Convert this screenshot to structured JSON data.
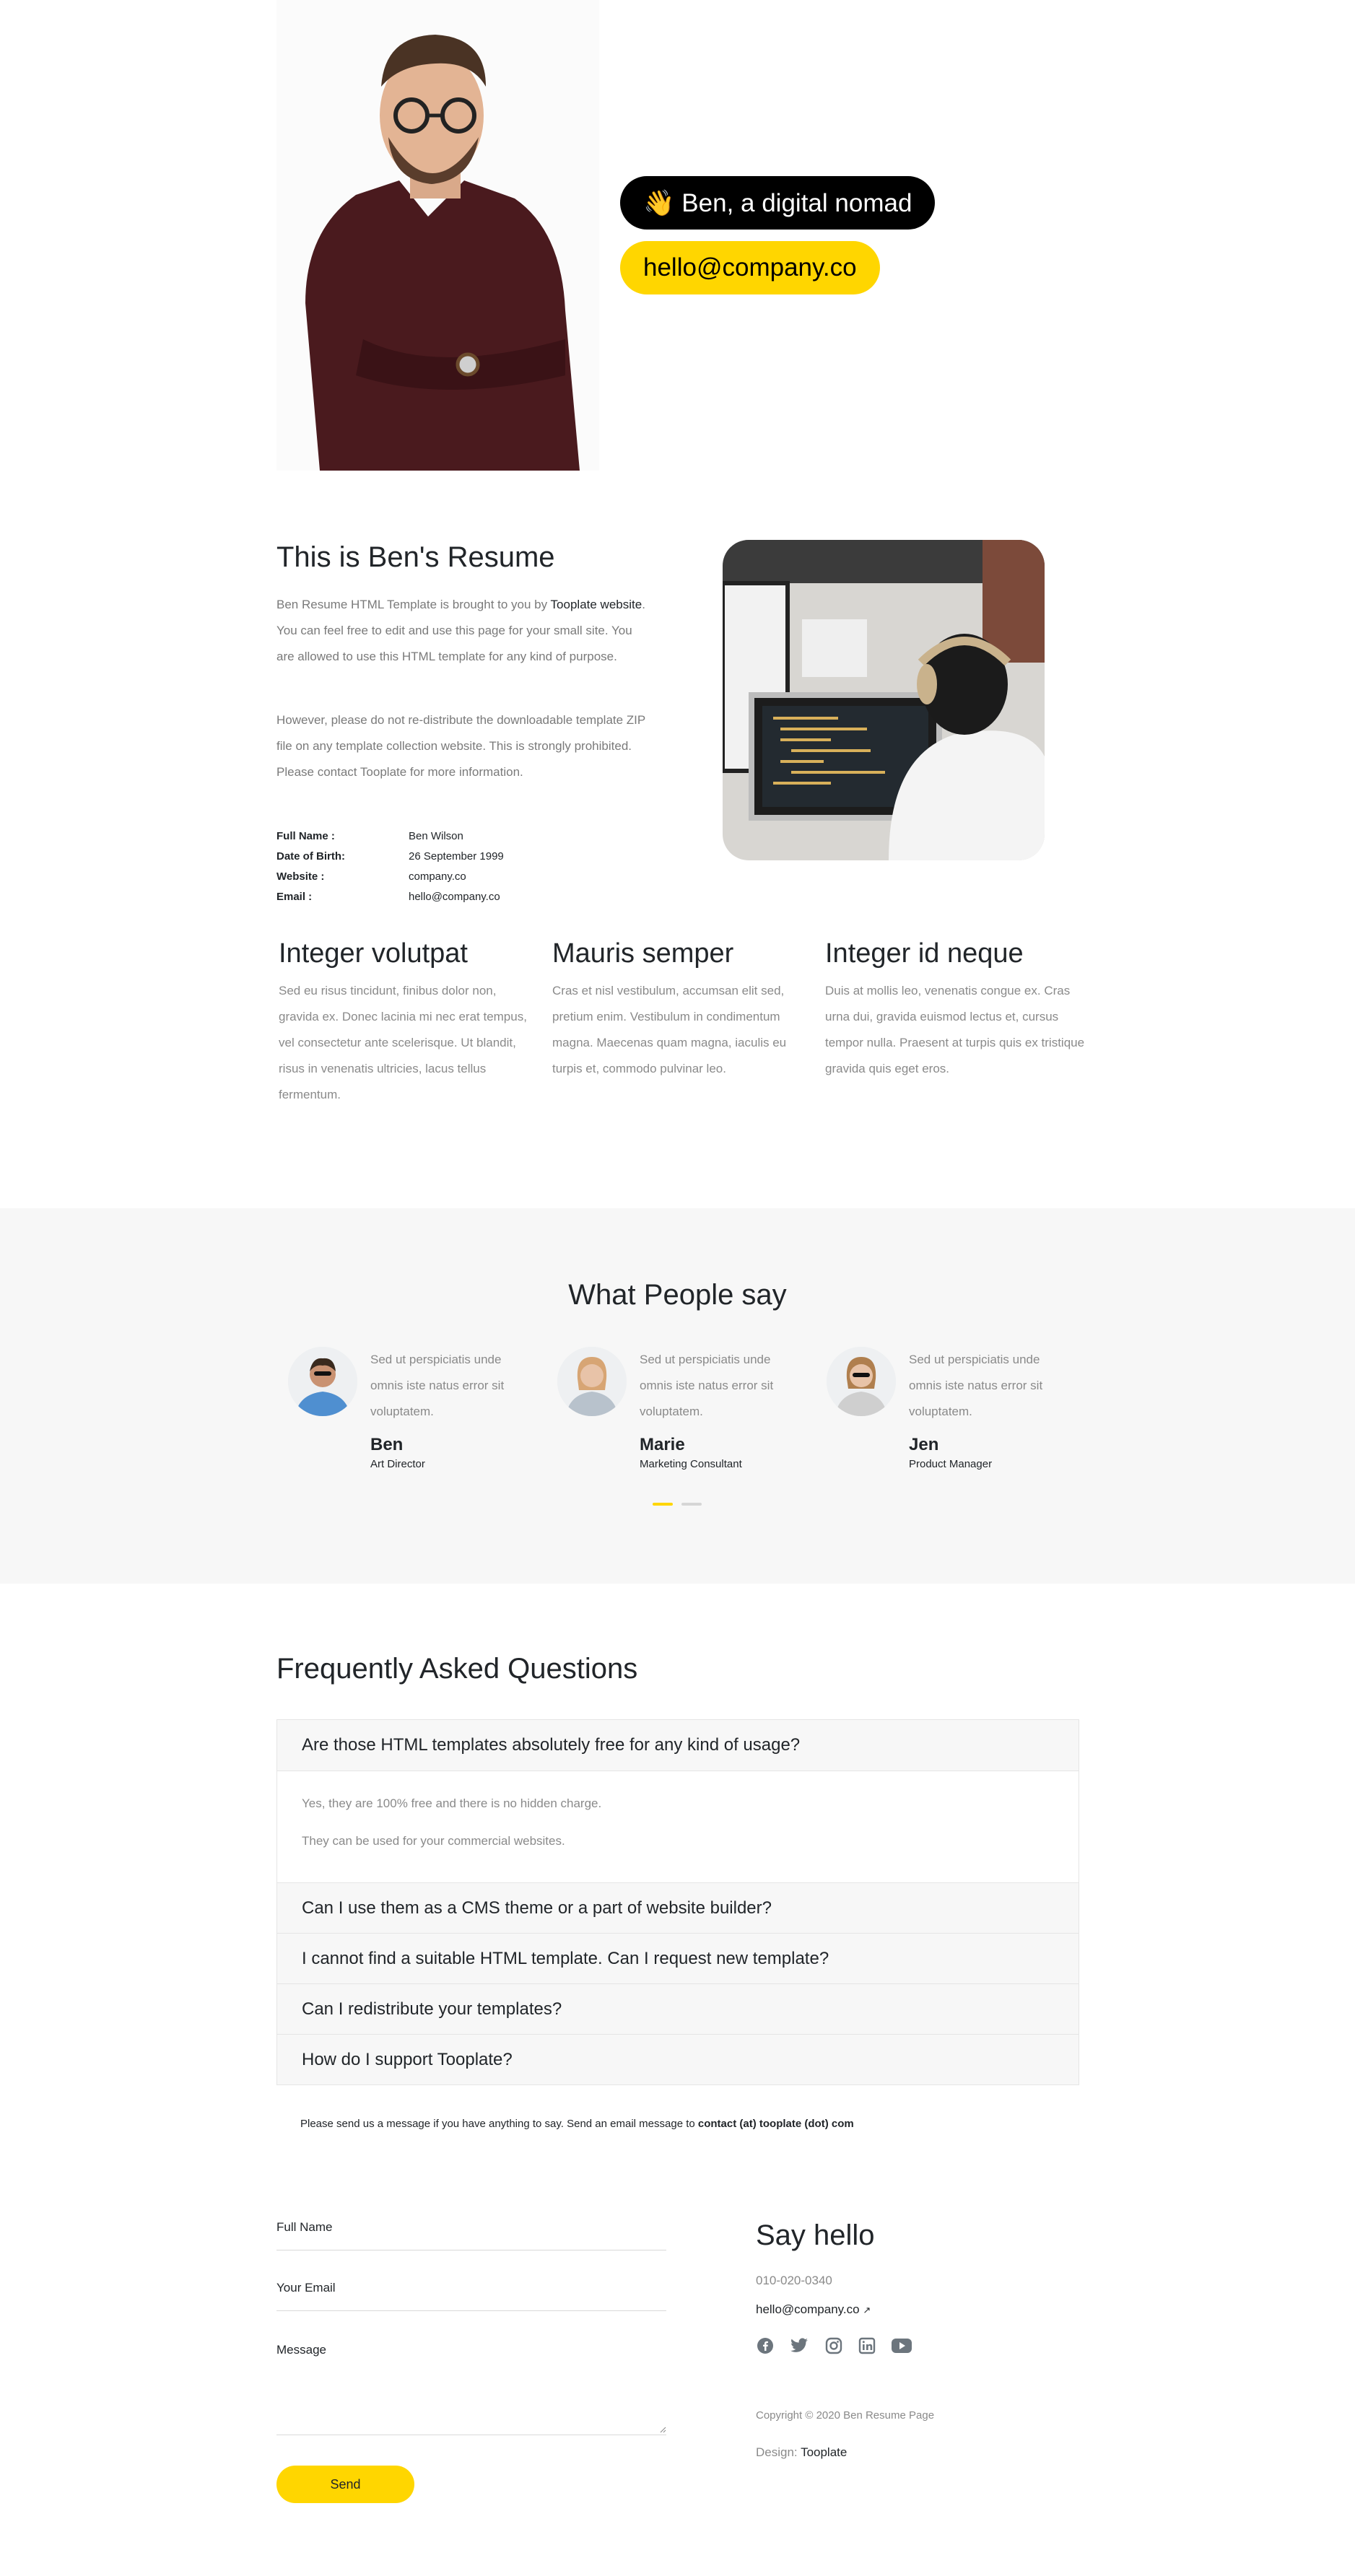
{
  "hero": {
    "name_pill": "👋 Ben, a digital nomad",
    "email_pill": "hello@company.co"
  },
  "about": {
    "title": "This is Ben's Resume",
    "p1_a": "Ben Resume HTML Template is brought to you by ",
    "p1_link": "Tooplate website",
    "p1_b": ". You can feel free to edit and use this page for your small site. You are allowed to use this HTML template for any kind of purpose.",
    "p2": "However, please do not re-distribute the downloadable template ZIP file on any template collection website. This is strongly prohibited. Please contact Tooplate for more information.",
    "info": [
      {
        "k": "Full Name :",
        "v": "Ben Wilson"
      },
      {
        "k": "Date of Birth:",
        "v": "26 September 1999"
      },
      {
        "k": "Website :",
        "v": "company.co"
      },
      {
        "k": "Email :",
        "v": "hello@company.co"
      }
    ]
  },
  "features": [
    {
      "title": "Integer volutpat",
      "text": "Sed eu risus tincidunt, finibus dolor non, gravida ex. Donec lacinia mi nec erat tempus, vel consectetur ante scelerisque. Ut blandit, risus in venenatis ultricies, lacus tellus fermentum."
    },
    {
      "title": "Mauris semper",
      "text": "Cras et nisl vestibulum, accumsan elit sed, pretium enim. Vestibulum in condimentum magna. Maecenas quam magna, iaculis eu turpis et, commodo pulvinar leo."
    },
    {
      "title": "Integer id neque",
      "text": "Duis at mollis leo, venenatis congue ex. Cras urna dui, gravida euismod lectus et, cursus tempor nulla. Praesent at turpis quis ex tristique gravida quis eget eros."
    }
  ],
  "testimonials": {
    "title": "What People say",
    "items": [
      {
        "quote": "Sed ut perspiciatis unde omnis iste natus error sit voluptatem.",
        "name": "Ben",
        "role": "Art Director"
      },
      {
        "quote": "Sed ut perspiciatis unde omnis iste natus error sit voluptatem.",
        "name": "Marie",
        "role": "Marketing Consultant"
      },
      {
        "quote": "Sed ut perspiciatis unde omnis iste natus error sit voluptatem.",
        "name": "Jen",
        "role": "Product Manager"
      }
    ]
  },
  "faq": {
    "title": "Frequently Asked Questions",
    "q1": "Are those HTML templates absolutely free for any kind of usage?",
    "a1_1": "Yes, they are 100% free and there is no hidden charge.",
    "a1_2": "They can be used for your commercial websites.",
    "q2": "Can I use them as a CMS theme or a part of website builder?",
    "q3": "I cannot find a suitable HTML template. Can I request new template?",
    "q4": "Can I redistribute your templates?",
    "q5": "How do I support Tooplate?",
    "note": "Please send us a message if you have anything to say. Send an email message to ",
    "note_bold": "contact (at) tooplate (dot) com"
  },
  "contact": {
    "full_name_label": "Full Name",
    "email_label": "Your Email",
    "message_label": "Message",
    "send_label": "Send",
    "say_hello": "Say hello",
    "phone": "010-020-0340",
    "email": "hello@company.co",
    "email_arrow": "↗",
    "copyright": "Copyright © 2020 Ben Resume Page",
    "design_label": "Design: ",
    "design_link": "Tooplate"
  },
  "colors": {
    "accent": "#ffd600",
    "dark": "#000000",
    "gray_bg": "#f7f7f7"
  },
  "icons": [
    "facebook-icon",
    "twitter-icon",
    "instagram-icon",
    "linkedin-icon",
    "youtube-icon"
  ]
}
